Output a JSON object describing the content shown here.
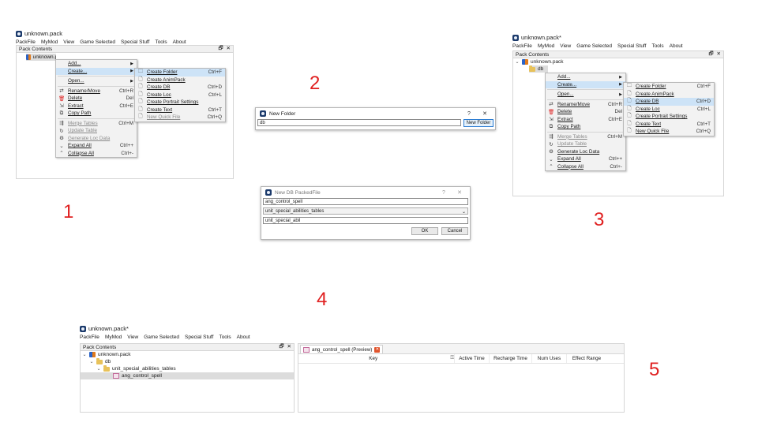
{
  "app": {
    "title": "unknown.pack",
    "title_modified": "unknown.pack*",
    "menu": [
      "PackFile",
      "MyMod",
      "View",
      "Game Selected",
      "Special Stuff",
      "Tools",
      "About"
    ],
    "dock_title": "Pack Contents",
    "dock_buttons": [
      "🗗",
      "✕"
    ],
    "tree_root": "unknown.pack",
    "tree_root_short": "unknown.pack"
  },
  "context_menu": [
    {
      "icon": "",
      "label": "Add...",
      "shortcut": "",
      "arrow": true
    },
    {
      "icon": "",
      "label": "Create...",
      "shortcut": "",
      "arrow": true
    },
    {
      "sep": true
    },
    {
      "icon": "",
      "label": "Open...",
      "shortcut": "",
      "arrow": true
    },
    {
      "sep": true
    },
    {
      "icon": "⇄",
      "label": "Rename/Move",
      "shortcut": "Ctrl+R"
    },
    {
      "icon": "🗑",
      "label": "Delete",
      "shortcut": "Del",
      "red": true
    },
    {
      "icon": "⇲",
      "label": "Extract",
      "shortcut": "Ctrl+E"
    },
    {
      "icon": "⧉",
      "label": "Copy Path",
      "shortcut": ""
    },
    {
      "sep": true
    },
    {
      "icon": "⇶",
      "label": "Merge Tables",
      "shortcut": "Ctrl+M",
      "disabled": true
    },
    {
      "icon": "↻",
      "label": "Update Table",
      "shortcut": "",
      "disabled": true
    },
    {
      "icon": "⚙",
      "label": "Generate Loc Data",
      "shortcut": ""
    },
    {
      "icon": "⌄",
      "label": "Expand All",
      "shortcut": "Ctrl++"
    },
    {
      "icon": "⌃",
      "label": "Collapse All",
      "shortcut": "Ctrl+-"
    }
  ],
  "context_menu_1_shortcuts": [
    "",
    "",
    "",
    "",
    "Ctrl+R",
    "Del",
    "Ctrl+E",
    "",
    "Ctrl+M",
    "",
    "",
    "Ctrl++",
    "Ctrl+-"
  ],
  "create_submenu": [
    {
      "icon": "🗀",
      "label": "Create Folder",
      "shortcut": "Ctrl+F"
    },
    {
      "icon": "🗋",
      "label": "Create AnimPack",
      "shortcut": ""
    },
    {
      "icon": "🗋",
      "label": "Create DB",
      "shortcut": "Ctrl+D"
    },
    {
      "icon": "🗋",
      "label": "Create Loc",
      "shortcut": "Ctrl+L"
    },
    {
      "icon": "🗋",
      "label": "Create Portrait Settings",
      "shortcut": ""
    },
    {
      "icon": "🗋",
      "label": "Create Text",
      "shortcut": "Ctrl+T"
    },
    {
      "icon": "🗋",
      "label": "New Quick File",
      "shortcut": "Ctrl+Q"
    }
  ],
  "steps": {
    "s1": "1",
    "s2": "2",
    "s3": "3",
    "s4": "4",
    "s5": "5"
  },
  "new_folder_dialog": {
    "title": "New Folder",
    "help": "?",
    "close": "✕",
    "value": "db",
    "button": "New Folder"
  },
  "new_db_dialog": {
    "title": "New DB PackedFile",
    "help": "?",
    "close": "✕",
    "name_value": "ang_control_spell",
    "table_value": "unit_special_abilities_tables",
    "filter_value": "unit_special_abil",
    "ok": "OK",
    "cancel": "Cancel"
  },
  "panel3": {
    "folder": "db"
  },
  "panel5": {
    "folder_db": "db",
    "folder_table": "unit_special_abilities_tables",
    "file": "ang_control_spell",
    "tab_label": "ang_control_spell (Preview)",
    "columns": [
      "Key",
      "Active Time",
      "Recharge Time",
      "Num Uses",
      "Effect Range"
    ]
  }
}
